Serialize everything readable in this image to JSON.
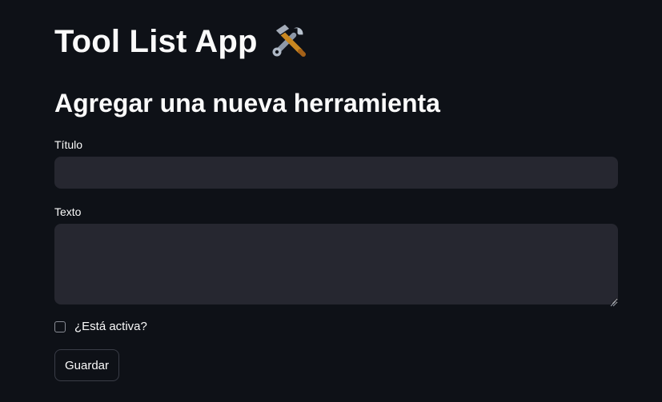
{
  "app": {
    "title": "Tool List App",
    "title_icon": "hammer-and-wrench-icon"
  },
  "form": {
    "heading": "Agregar una nueva herramienta",
    "titulo_label": "Título",
    "titulo_value": "",
    "texto_label": "Texto",
    "texto_value": "",
    "activa_label": "¿Está activa?",
    "activa_checked": false,
    "save_label": "Guardar"
  },
  "theme": {
    "background": "#0e1117",
    "input_background": "#262730",
    "text": "#fafafa",
    "border": "#3a3d47"
  }
}
